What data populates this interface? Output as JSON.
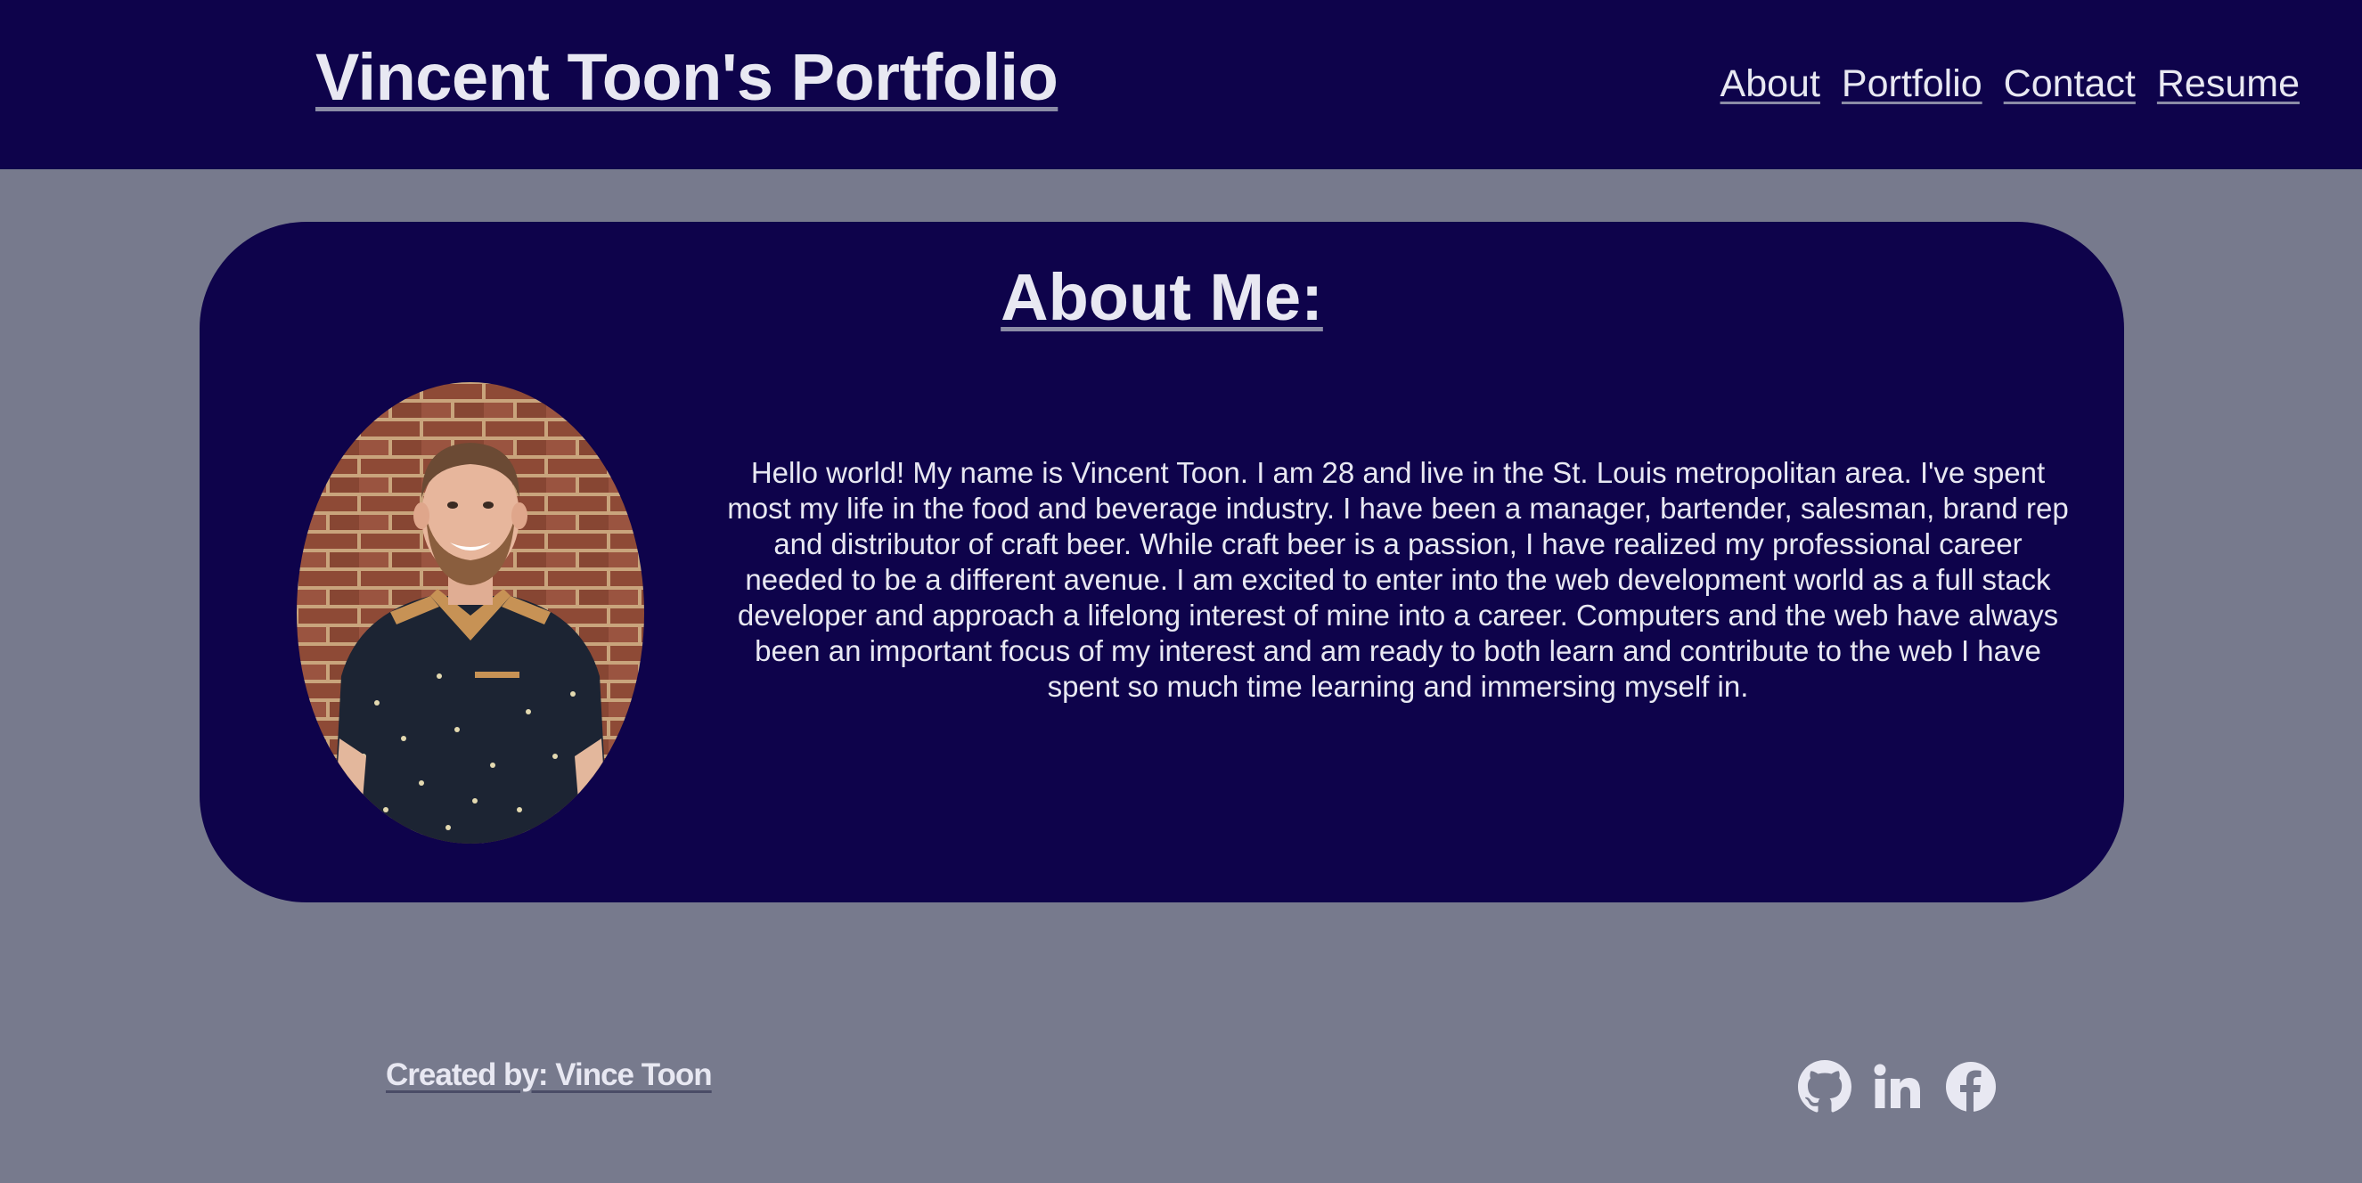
{
  "header": {
    "title": "Vincent Toon's Portfolio",
    "nav": [
      {
        "label": "About"
      },
      {
        "label": "Portfolio"
      },
      {
        "label": "Contact"
      },
      {
        "label": "Resume"
      }
    ]
  },
  "about": {
    "heading": "About Me:",
    "bio": "Hello world! My name is Vincent Toon. I am 28 and live in the St. Louis metropolitan area. I've spent most my life in the food and beverage industry. I have been a manager, bartender, salesman, brand rep and distributor of craft beer. While craft beer is a passion, I have realized my professional career needed to be a different avenue. I am excited to enter into the web development world as a full stack developer and approach a lifelong interest of mine into a career. Computers and the web have always been an important focus of my interest and am ready to both learn and contribute to the web I have spent so much time learning and immersing myself in."
  },
  "footer": {
    "credit": "Created by: Vince Toon",
    "social_icons": [
      "github-icon",
      "linkedin-icon",
      "facebook-icon"
    ]
  },
  "colors": {
    "header_bg": "#0e034b",
    "page_bg": "#777a8d",
    "card_bg": "#0e034b",
    "text": "#e8e8f2"
  }
}
